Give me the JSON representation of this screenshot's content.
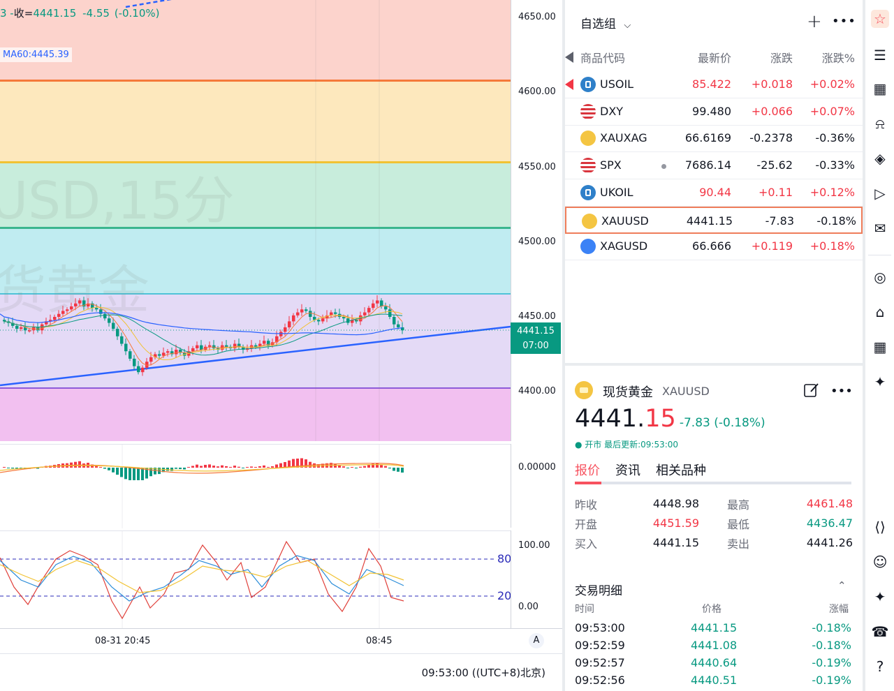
{
  "chart": {
    "legend": {
      "prefix": "3 -",
      "close_label": "收=",
      "close_value": "4441.15",
      "change": "-4.55",
      "change_pct": "(-0.10%)"
    },
    "ma_label": "MA60:4445.39",
    "watermark_line1": "USD,15分",
    "watermark_line2": "货黄金",
    "price_ticks": [
      "4650.00",
      "4600.00",
      "4550.00",
      "4500.00",
      "4450.00",
      "4400.00"
    ],
    "last_price": "4441.15",
    "last_countdown": "07:00",
    "macd_tick": "0.00000",
    "kdj_ticks": [
      "100.00",
      "0.00"
    ],
    "kdj_levels": [
      "80",
      "20"
    ],
    "time_ticks": [
      "08-31 20:45",
      "08:45"
    ],
    "auto_button": "A",
    "clock": "09:53:00 ((UTC+8)北京)",
    "colors": {
      "fib_bands": [
        "#fcd3cc",
        "#fde8bd",
        "#c8eddc",
        "#c0ecf1",
        "#e4daf6",
        "#f2c0f0"
      ],
      "fib_lines": [
        "#f5793a",
        "#f1c232",
        "#3bb68e",
        "#4fc3d8",
        "#8e5bd8"
      ],
      "up": "#f23645",
      "down": "#089981",
      "trendline": "#2962ff"
    }
  },
  "watchlist": {
    "title": "自选组",
    "headers": [
      "商品代码",
      "最新价",
      "涨跌",
      "涨跌%"
    ],
    "rows": [
      {
        "symbol": "USOIL",
        "icon": "oil-icon",
        "last": "85.422",
        "chg": "+0.018",
        "pct": "+0.02%",
        "dir": "up",
        "last_color": "up",
        "flag": true
      },
      {
        "symbol": "DXY",
        "icon": "us-flag-icon",
        "last": "99.480",
        "chg": "+0.066",
        "pct": "+0.07%",
        "dir": "up",
        "last_color": "neutral"
      },
      {
        "symbol": "XAUXAG",
        "icon": "gold-silver-icon",
        "last": "66.6169",
        "chg": "-0.2378",
        "pct": "-0.36%",
        "dir": "down",
        "last_color": "neutral"
      },
      {
        "symbol": "SPX",
        "icon": "us-flag-icon",
        "last": "7686.14",
        "chg": "-25.62",
        "pct": "-0.33%",
        "dir": "down",
        "last_color": "neutral",
        "dot": true
      },
      {
        "symbol": "UKOIL",
        "icon": "oil-icon",
        "last": "90.44",
        "chg": "+0.11",
        "pct": "+0.12%",
        "dir": "up",
        "last_color": "up"
      },
      {
        "symbol": "XAUUSD",
        "icon": "gold-icon",
        "last": "4441.15",
        "chg": "-7.83",
        "pct": "-0.18%",
        "dir": "down",
        "last_color": "neutral",
        "selected": true
      },
      {
        "symbol": "XAGUSD",
        "icon": "silver-icon",
        "last": "66.666",
        "chg": "+0.119",
        "pct": "+0.18%",
        "dir": "up",
        "last_color": "neutral"
      }
    ]
  },
  "detail": {
    "name": "现货黄金",
    "symbol": "XAUUSD",
    "price_int": "4441.",
    "price_dec": "15",
    "change": "-7.83 (-0.18%)",
    "status": "● 开市 最后更新:09:53:00",
    "tabs": [
      "报价",
      "资讯",
      "相关品种"
    ],
    "stats": [
      {
        "label": "昨收",
        "value": "4448.98",
        "dir": "neutral"
      },
      {
        "label": "最高",
        "value": "4461.48",
        "dir": "up"
      },
      {
        "label": "开盘",
        "value": "4451.59",
        "dir": "up"
      },
      {
        "label": "最低",
        "value": "4436.47",
        "dir": "down"
      },
      {
        "label": "买入",
        "value": "4441.15",
        "dir": "neutral"
      },
      {
        "label": "卖出",
        "value": "4441.26",
        "dir": "neutral"
      }
    ],
    "trades_title": "交易明细",
    "trades_headers": [
      "时间",
      "价格",
      "涨幅"
    ],
    "trades": [
      {
        "time": "09:53:00",
        "price": "4441.15",
        "pct": "-0.18%"
      },
      {
        "time": "09:52:59",
        "price": "4441.08",
        "pct": "-0.18%"
      },
      {
        "time": "09:52:57",
        "price": "4440.64",
        "pct": "-0.19%"
      },
      {
        "time": "09:52:56",
        "price": "4440.51",
        "pct": "-0.19%"
      }
    ]
  },
  "sidebar": {
    "icons": [
      "watchlist-icon",
      "news-icon",
      "calendar-icon",
      "alert-icon",
      "layers-icon",
      "video-icon",
      "chat-icon",
      "target-icon",
      "education-icon",
      "grid-icon",
      "network-icon",
      "code-icon",
      "robot-icon",
      "handshake-icon",
      "support-icon",
      "help-icon"
    ]
  }
}
